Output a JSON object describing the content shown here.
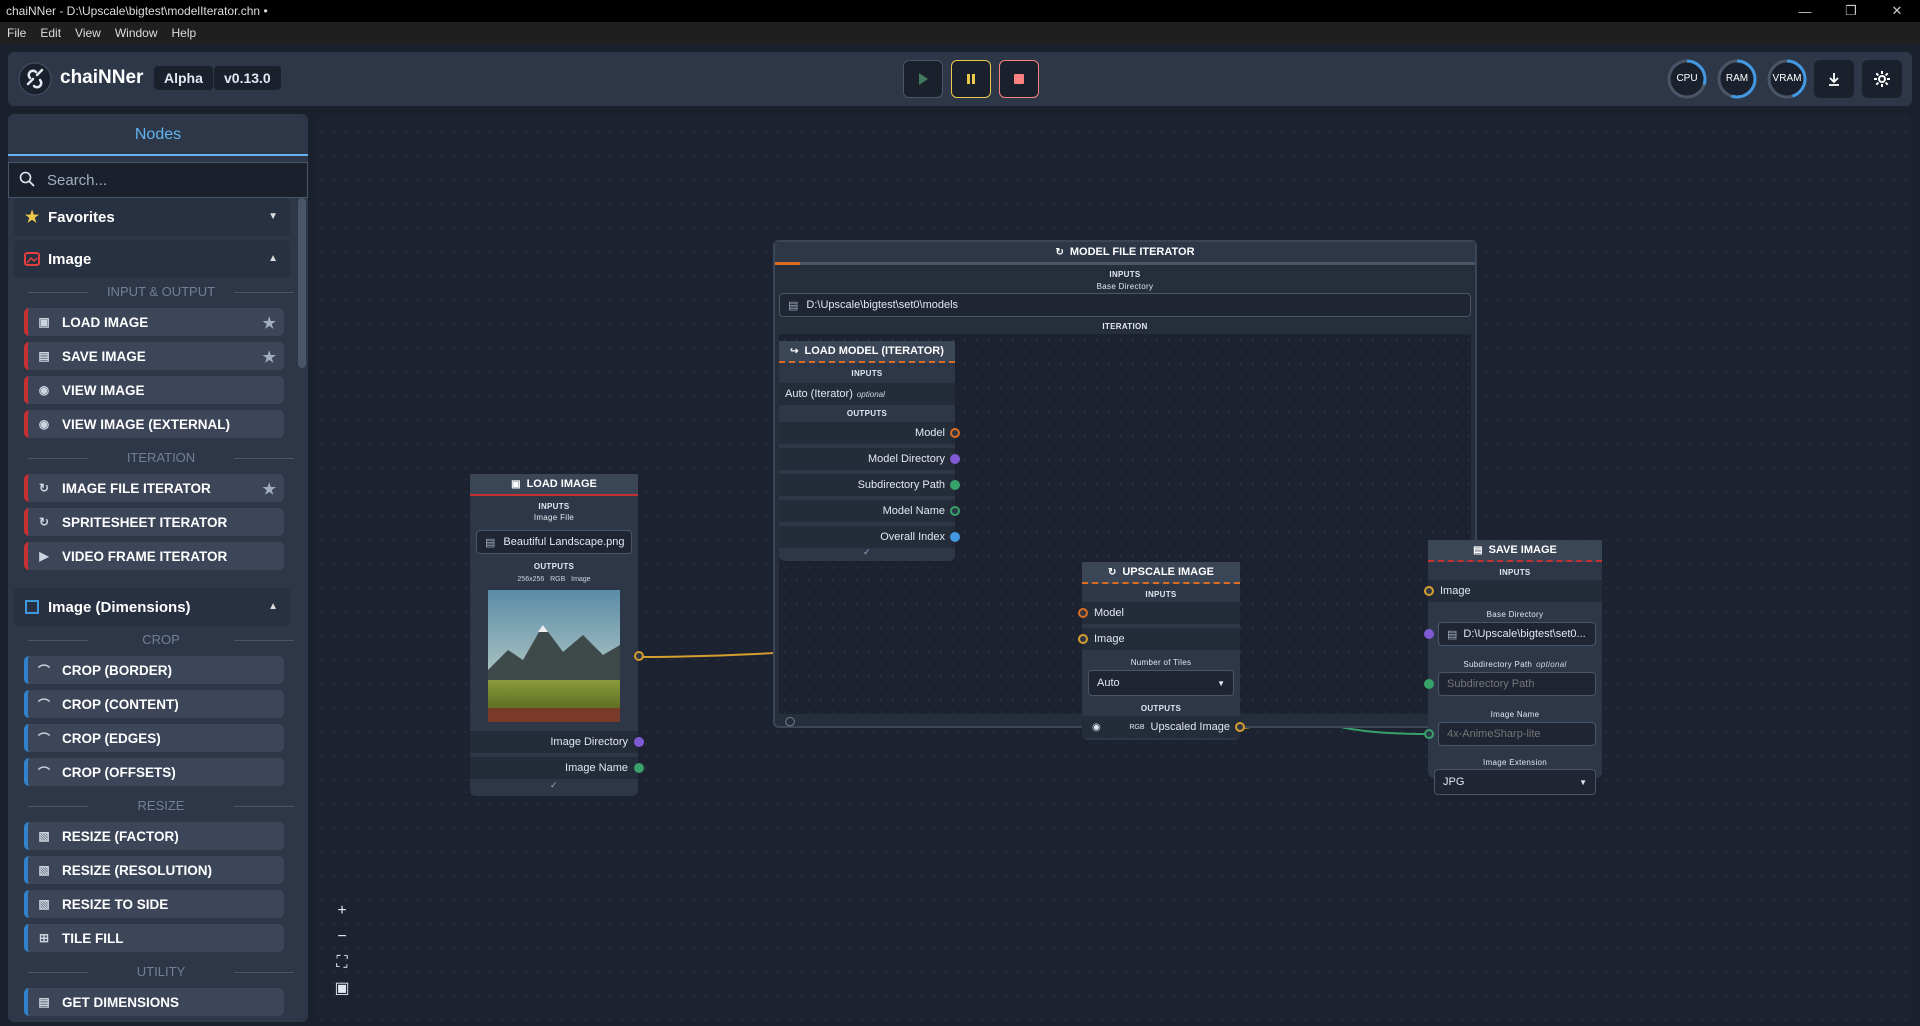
{
  "window": {
    "title": "chaiNNer - D:\\Upscale\\bigtest\\modelIterator.chn •"
  },
  "menu": [
    "File",
    "Edit",
    "View",
    "Window",
    "Help"
  ],
  "header": {
    "app": "chaiNNer",
    "channel": "Alpha",
    "version": "v0.13.0",
    "gauges": [
      {
        "label": "CPU",
        "level": 0.3
      },
      {
        "label": "RAM",
        "level": 0.55
      },
      {
        "label": "VRAM",
        "level": 0.45
      }
    ]
  },
  "sidebar": {
    "tab": "Nodes",
    "search_placeholder": "Search...",
    "favorites": "Favorites",
    "cat_image": "Image",
    "sec_io": "INPUT & OUTPUT",
    "io": [
      "LOAD IMAGE",
      "SAVE IMAGE",
      "VIEW IMAGE",
      "VIEW IMAGE (EXTERNAL)"
    ],
    "sec_iter": "ITERATION",
    "iter": [
      "IMAGE FILE ITERATOR",
      "SPRITESHEET ITERATOR",
      "VIDEO FRAME ITERATOR"
    ],
    "cat_dim": "Image (Dimensions)",
    "sec_crop": "CROP",
    "crop": [
      "CROP (BORDER)",
      "CROP (CONTENT)",
      "CROP (EDGES)",
      "CROP (OFFSETS)"
    ],
    "sec_resize": "RESIZE",
    "resize": [
      "RESIZE (FACTOR)",
      "RESIZE (RESOLUTION)",
      "RESIZE TO SIDE",
      "TILE FILL"
    ],
    "sec_util": "UTILITY",
    "util": [
      "GET DIMENSIONS"
    ]
  },
  "nodes": {
    "load_image": {
      "title": "LOAD IMAGE",
      "inputs": "INPUTS",
      "file_label": "Image File",
      "file": "Beautiful Landscape.png",
      "outputs": "OUTPUTS",
      "size": "256x256",
      "mode": "RGB",
      "img_label": "Image",
      "out1": "Image Directory",
      "out2": "Image Name"
    },
    "iterator": {
      "title": "MODEL FILE ITERATOR",
      "inputs": "INPUTS",
      "dir_label": "Base Directory",
      "dir": "D:\\Upscale\\bigtest\\set0\\models",
      "iteration": "ITERATION"
    },
    "load_model": {
      "title": "LOAD MODEL (ITERATOR)",
      "inputs": "INPUTS",
      "auto": "Auto (Iterator)",
      "optional": "optional",
      "outputs": "OUTPUTS",
      "out": [
        "Model",
        "Model Directory",
        "Subdirectory Path",
        "Model Name",
        "Overall Index"
      ]
    },
    "upscale": {
      "title": "UPSCALE IMAGE",
      "inputs": "INPUTS",
      "in1": "Model",
      "in2": "Image",
      "tiles_label": "Number of Tiles",
      "tiles": "Auto",
      "outputs": "OUTPUTS",
      "mode": "RGB",
      "out": "Upscaled Image"
    },
    "save": {
      "title": "SAVE IMAGE",
      "inputs": "INPUTS",
      "in_image": "Image",
      "dir_label": "Base Directory",
      "dir": "D:\\Upscale\\bigtest\\set0...",
      "sub_label": "Subdirectory Path",
      "optional": "optional",
      "sub_placeholder": "Subdirectory Path",
      "name_label": "Image Name",
      "name_placeholder": "4x-AnimeSharp-lite",
      "ext_label": "Image Extension",
      "ext": "JPG"
    }
  },
  "colors": {
    "image": "#c53030",
    "dims": "#3182ce",
    "orange": "#dd6b20",
    "yellow": "#ecc94b",
    "green": "#38a169",
    "purple": "#805ad5",
    "blue": "#4299e1",
    "accent": "#63b3ed"
  }
}
